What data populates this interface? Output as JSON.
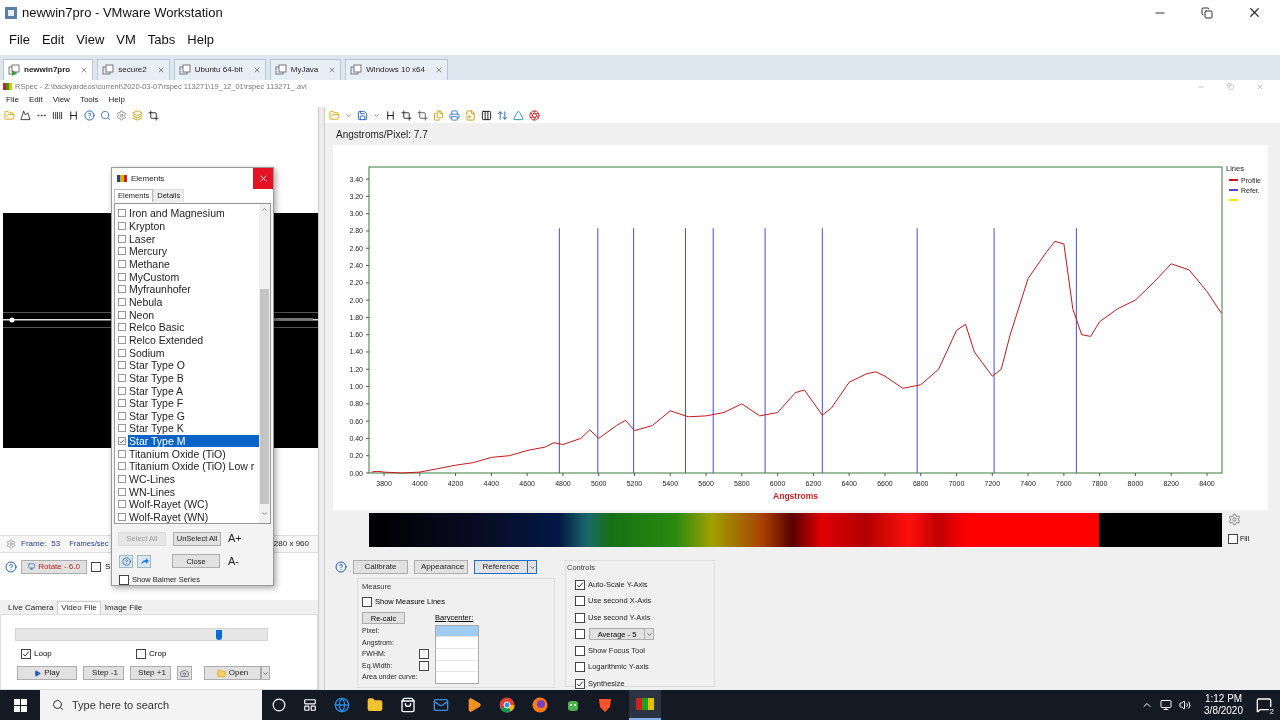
{
  "window": {
    "title": "newwin7pro - VMware Workstation"
  },
  "menu": [
    "File",
    "Edit",
    "View",
    "VM",
    "Tabs",
    "Help"
  ],
  "vm_tabs": [
    {
      "label": "newwin7pro",
      "selected": true
    },
    {
      "label": "secure2",
      "selected": false
    },
    {
      "label": "Ubuntu 64-bit",
      "selected": false
    },
    {
      "label": "MyJava",
      "selected": false
    },
    {
      "label": "Windows 10 x64",
      "selected": false
    }
  ],
  "guest": {
    "title": "RSpec - Z:\\backyardeos\\current\\2020-03-07\\rspec 113271\\19_12_01\\rspec 113271_.avi",
    "menu": [
      "File",
      "Edit",
      "View",
      "Tools",
      "Help"
    ],
    "left": {
      "status": {
        "frame_label": "Frame:",
        "frame": "53",
        "fps_label": "Frames/sec",
        "resolution": "280 x 960"
      },
      "rotate_button": "Rotate - 6.0",
      "side_checkbox": {
        "label": "S",
        "checked": false
      },
      "tabs": [
        {
          "label": "Live Camera",
          "selected": false
        },
        {
          "label": "Video File",
          "selected": true
        },
        {
          "label": "Image File",
          "selected": false
        }
      ],
      "slider": {
        "level": 0.81
      },
      "options": [
        {
          "label": "Loop",
          "checked": true
        },
        {
          "label": "Crop",
          "checked": false
        }
      ],
      "buttons": [
        {
          "kind": "play",
          "label": "Play"
        },
        {
          "kind": "step_back",
          "label": "Step -1"
        },
        {
          "kind": "step_forward",
          "label": "Step +1"
        },
        {
          "kind": "snapshot"
        },
        {
          "kind": "open",
          "label": "Open"
        },
        {
          "kind": "menu"
        }
      ]
    },
    "elements_dialog": {
      "title": "Elements",
      "tabs": [
        {
          "label": "Elements",
          "selected": true
        },
        {
          "label": "Details",
          "selected": false
        }
      ],
      "items": [
        {
          "label": "Iron and Magnesium",
          "checked": false,
          "selected": false
        },
        {
          "label": "Krypton",
          "checked": false,
          "selected": false
        },
        {
          "label": "Laser",
          "checked": false,
          "selected": false
        },
        {
          "label": "Mercury",
          "checked": false,
          "selected": false
        },
        {
          "label": "Methane",
          "checked": false,
          "selected": false
        },
        {
          "label": "MyCustom",
          "checked": false,
          "selected": false
        },
        {
          "label": "Myfraunhofer",
          "checked": false,
          "selected": false
        },
        {
          "label": "Nebula",
          "checked": false,
          "selected": false
        },
        {
          "label": "Neon",
          "checked": false,
          "selected": false
        },
        {
          "label": "Relco Basic",
          "checked": false,
          "selected": false
        },
        {
          "label": "Relco Extended",
          "checked": false,
          "selected": false
        },
        {
          "label": "Sodium",
          "checked": false,
          "selected": false
        },
        {
          "label": "Star Type O",
          "checked": false,
          "selected": false
        },
        {
          "label": "Star Type B",
          "checked": false,
          "selected": false
        },
        {
          "label": "Star Type A",
          "checked": false,
          "selected": false
        },
        {
          "label": "Star Type F",
          "checked": false,
          "selected": false
        },
        {
          "label": "Star Type G",
          "checked": false,
          "selected": false
        },
        {
          "label": "Star Type K",
          "checked": false,
          "selected": false
        },
        {
          "label": "Star Type M",
          "checked": true,
          "selected": true
        },
        {
          "label": "Titanium Oxide (TiO)",
          "checked": false,
          "selected": false
        },
        {
          "label": "Titanium Oxide (TiO) Low r",
          "checked": false,
          "selected": false
        },
        {
          "label": "WC-Lines",
          "checked": false,
          "selected": false
        },
        {
          "label": "WN-Lines",
          "checked": false,
          "selected": false
        },
        {
          "label": "Wolf-Rayet (WC)",
          "checked": false,
          "selected": false
        },
        {
          "label": "Wolf-Rayet (WN)",
          "checked": false,
          "selected": false
        }
      ],
      "select_all": {
        "label": "Select All",
        "disabled": true
      },
      "unselect_all": {
        "label": "UnSelect All",
        "disabled": false
      },
      "font_larger": "A+",
      "font_smaller": "A-",
      "close": "Close",
      "balmer": {
        "label": "Show Balmer Series",
        "checked": false
      }
    },
    "right": {
      "scale_label": "Angstroms/Pixel: 7.7",
      "chart": {
        "legend_title": "Lines",
        "legend": [
          {
            "label": "Refer.",
            "color": "#4a4ae0"
          },
          {
            "color": "#f0e800"
          }
        ],
        "chart_data": {
          "type": "line",
          "xlabel": "Angstroms",
          "x": [
            3730,
            3760,
            3800,
            3900,
            4000,
            4100,
            4200,
            4300,
            4400,
            4500,
            4600,
            4700,
            4750,
            4800,
            4900,
            4950,
            5000,
            5100,
            5150,
            5200,
            5300,
            5400,
            5500,
            5600,
            5700,
            5800,
            5900,
            6000,
            6100,
            6150,
            6250,
            6300,
            6400,
            6500,
            6550,
            6600,
            6700,
            6800,
            6900,
            7000,
            7050,
            7100,
            7200,
            7250,
            7300,
            7400,
            7500,
            7550,
            7600,
            7650,
            7700,
            7750,
            7800,
            7900,
            8000,
            8100,
            8200,
            8300,
            8400,
            8480
          ],
          "series": [
            {
              "name": "Profile",
              "color": "#c41818",
              "values": [
                0.01,
                0.02,
                0.01,
                0.0,
                0.01,
                0.05,
                0.09,
                0.12,
                0.18,
                0.2,
                0.26,
                0.3,
                0.35,
                0.33,
                0.4,
                0.5,
                0.4,
                0.55,
                0.61,
                0.49,
                0.55,
                0.72,
                0.65,
                0.66,
                0.7,
                0.8,
                0.66,
                0.7,
                0.93,
                0.96,
                0.67,
                0.75,
                1.05,
                1.15,
                1.17,
                1.12,
                0.98,
                1.02,
                1.2,
                1.65,
                1.72,
                1.4,
                1.12,
                1.2,
                1.6,
                2.25,
                2.55,
                2.68,
                2.65,
                1.9,
                1.6,
                1.58,
                1.75,
                1.9,
                2.0,
                2.2,
                2.42,
                2.35,
                2.1,
                1.85
              ]
            }
          ],
          "xlim": [
            3716,
            8484
          ],
          "ylim": [
            0,
            3.54
          ],
          "xticks": [
            3800,
            4000,
            4200,
            4400,
            4600,
            4800,
            5000,
            5200,
            5400,
            5600,
            5800,
            6000,
            6200,
            6400,
            6600,
            6800,
            7000,
            7200,
            7400,
            7600,
            7800,
            8000,
            8200,
            8400
          ],
          "yticks": [
            {
              "value": 0,
              "label": "0.00"
            },
            {
              "value": 0.2,
              "label": "0.20"
            },
            {
              "value": 0.4,
              "label": "0.40"
            },
            {
              "value": 0.6,
              "label": "0.60"
            },
            {
              "value": 0.8,
              "label": "0.80"
            },
            {
              "value": 1.0,
              "label": "1.00"
            },
            {
              "value": 1.2,
              "label": "1.20"
            },
            {
              "value": 1.4,
              "label": "1.40"
            },
            {
              "value": 1.6,
              "label": "1.60"
            },
            {
              "value": 1.8,
              "label": "1.80"
            },
            {
              "value": 2.0,
              "label": "2.00"
            },
            {
              "value": 2.2,
              "label": "2.20"
            },
            {
              "value": 2.4,
              "label": "2.40"
            },
            {
              "value": 2.6,
              "label": "2.60"
            },
            {
              "value": 2.8,
              "label": "2.80"
            },
            {
              "value": 3.0,
              "label": "3.00"
            },
            {
              "value": 3.2,
              "label": "3.20"
            },
            {
              "value": 3.4,
              "label": "3.40"
            }
          ],
          "ref_lines": [
            {
              "axis": "x",
              "value": 4780
            },
            {
              "axis": "x",
              "value": 4995
            },
            {
              "axis": "x",
              "value": 5195
            },
            {
              "axis": "x",
              "value": 5485
            },
            {
              "axis": "x",
              "value": 5640
            },
            {
              "axis": "x",
              "value": 5930
            },
            {
              "axis": "x",
              "value": 6250
            },
            {
              "axis": "x",
              "value": 6780
            },
            {
              "axis": "x",
              "value": 7210
            },
            {
              "axis": "x",
              "value": 7670
            }
          ]
        }
      },
      "fill": {
        "label": "Fill",
        "checked": false
      },
      "buttons": [
        {
          "label": "Calibrate",
          "selected": false
        },
        {
          "label": "Appearance",
          "selected": false
        },
        {
          "label": "Reference",
          "selected": true
        }
      ],
      "measure": {
        "title": "Measure",
        "show_lines": {
          "label": "Show Measure Lines",
          "checked": false
        },
        "recalc": "Re-calc",
        "barycenter": "Barycenter:",
        "fields": [
          {
            "label": "Pixel:"
          },
          {
            "label": "Angstrom:"
          },
          {
            "label": "FWHM:",
            "checked": false
          },
          {
            "label": "Eq.Width:",
            "checked": false
          },
          {
            "label": "Area under curve:"
          }
        ],
        "barycenter_rows": [
          {
            "selected": true
          },
          {
            "selected": false
          },
          {
            "selected": false
          },
          {
            "selected": false
          },
          {
            "selected": false
          }
        ]
      },
      "controls": {
        "title": "Controls",
        "items": [
          {
            "kind": "checkbox",
            "label": "Auto-Scale Y-Axis",
            "checked": true
          },
          {
            "kind": "checkbox",
            "label": "Use second X-Axis",
            "checked": false
          },
          {
            "kind": "checkbox",
            "label": "Use second Y-Axis",
            "checked": false
          },
          {
            "kind": "dropdown",
            "label": "Average - 5",
            "checked": false
          },
          {
            "kind": "checkbox",
            "label": "Show Focus Tool",
            "checked": false
          },
          {
            "kind": "checkbox",
            "label": "Logarithmic Y-axis",
            "checked": false
          },
          {
            "kind": "checkbox",
            "label": "Synthesize",
            "checked": true
          }
        ]
      }
    }
  },
  "taskbar": {
    "search": {
      "placeholder": "Type here to search"
    },
    "time": "1:12 PM",
    "date": "3/8/2020",
    "notifications": "2"
  }
}
